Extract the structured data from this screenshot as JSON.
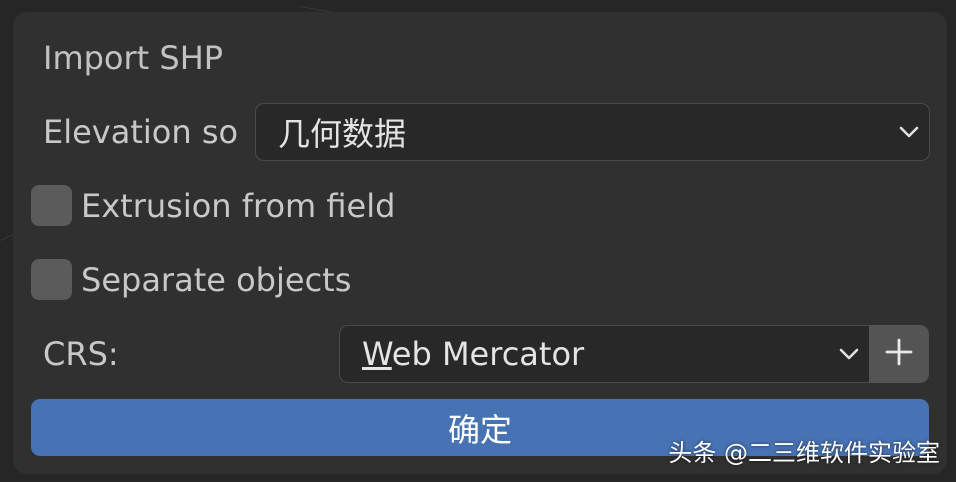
{
  "dialog": {
    "title": "Import SHP",
    "elevation": {
      "label": "Elevation so",
      "value": "几何数据"
    },
    "extrusion": {
      "label": "Extrusion from field",
      "checked": false
    },
    "separate": {
      "label": "Separate objects",
      "checked": false
    },
    "crs": {
      "label": "CRS:",
      "value": "Web Mercator"
    },
    "ok_label": "确定"
  },
  "watermark": "头条 @二三维软件实验室",
  "colors": {
    "accent": "#4772b3",
    "panel": "#303030",
    "field": "#282828",
    "checkbox": "#5b5b5b"
  }
}
